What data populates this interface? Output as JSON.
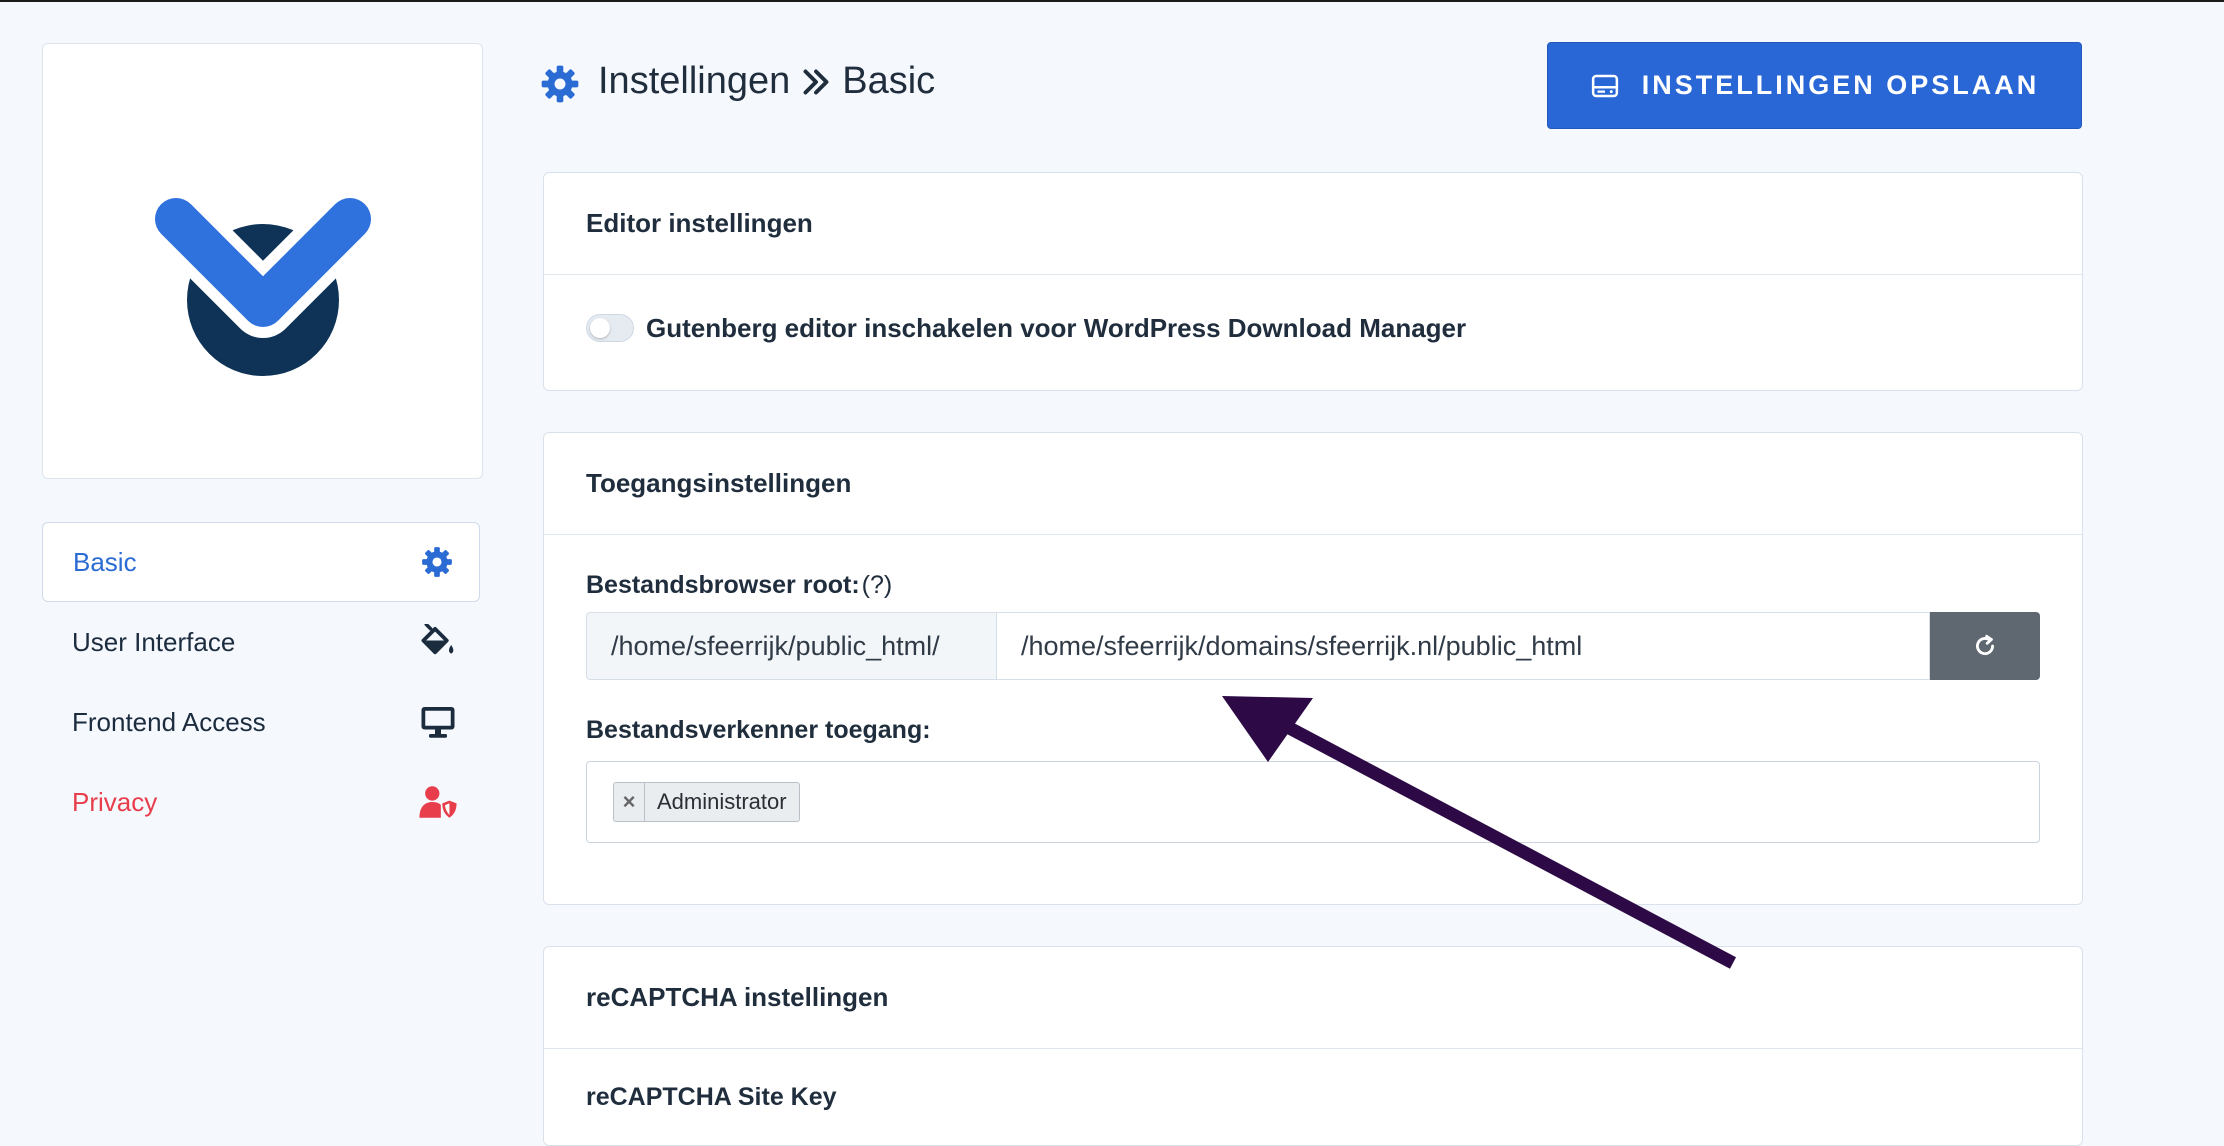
{
  "header": {
    "title": "Instellingen",
    "subtitle": "Basic",
    "save_button": "INSTELLINGEN OPSLAAN"
  },
  "sidebar": {
    "items": [
      {
        "label": "Basic",
        "icon": "gear-icon",
        "active": true
      },
      {
        "label": "User Interface",
        "icon": "paint-bucket-icon"
      },
      {
        "label": "Frontend Access",
        "icon": "desktop-icon"
      },
      {
        "label": "Privacy",
        "icon": "user-shield-icon"
      }
    ]
  },
  "editor": {
    "title": "Editor instellingen",
    "toggle_label": "Gutenberg editor inschakelen voor WordPress Download Manager",
    "toggle_on": false
  },
  "access": {
    "title": "Toegangsinstellingen",
    "root_label": "Bestandsbrowser root:",
    "root_help": "(?)",
    "root_prefix": "/home/sfeerrijk/public_html/",
    "root_value": "/home/sfeerrijk/domains/sfeerrijk.nl/public_html",
    "explorer_label": "Bestandsverkenner toegang:",
    "explorer_tags": [
      "Administrator"
    ]
  },
  "recaptcha": {
    "title": "reCAPTCHA instellingen",
    "site_key_label": "reCAPTCHA Site Key"
  },
  "colors": {
    "primary": "#2a67d6",
    "privacy": "#e83e4c",
    "arrow": "#2d0a45",
    "logo_dark": "#0f3356"
  }
}
